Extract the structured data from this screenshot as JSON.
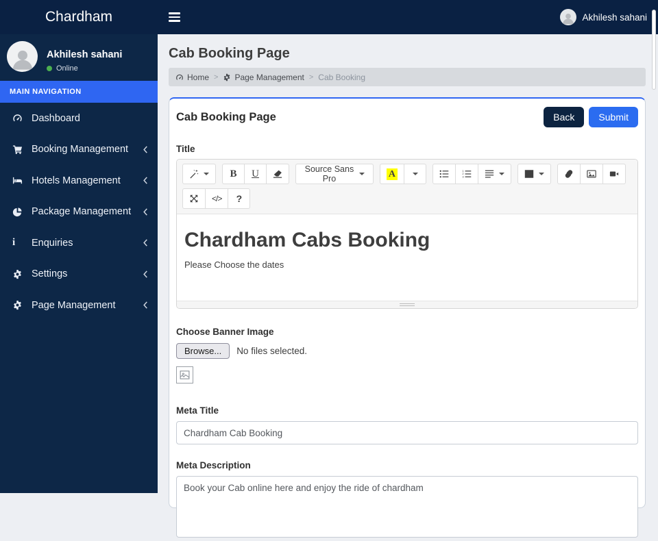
{
  "header": {
    "brand": "Chardham",
    "user_name": "Akhilesh sahani"
  },
  "sidebar": {
    "user": {
      "name": "Akhilesh sahani",
      "status": "Online"
    },
    "section_label": "MAIN NAVIGATION",
    "info_icon_letter": "i",
    "items": [
      {
        "label": "Dashboard",
        "icon": "tachometer",
        "has_children": false
      },
      {
        "label": "Booking Management",
        "icon": "cart",
        "has_children": true
      },
      {
        "label": "Hotels Management",
        "icon": "bed",
        "has_children": true
      },
      {
        "label": "Package Management",
        "icon": "pie-chart",
        "has_children": true
      },
      {
        "label": "Enquiries",
        "icon": "info",
        "has_children": true
      },
      {
        "label": "Settings",
        "icon": "gear",
        "has_children": true
      },
      {
        "label": "Page Management",
        "icon": "gear",
        "has_children": true
      }
    ]
  },
  "content": {
    "page_title": "Cab Booking Page",
    "breadcrumb": {
      "separator": ">",
      "items": [
        {
          "label": "Home",
          "icon": "tachometer"
        },
        {
          "label": "Page Management",
          "icon": "gear"
        },
        {
          "label": "Cab Booking"
        }
      ]
    },
    "card": {
      "title": "Cab Booking Page",
      "back_label": "Back",
      "submit_label": "Submit",
      "title_label": "Title",
      "editor": {
        "toolbar": {
          "bold": "B",
          "underline": "U",
          "font_name": "Source Sans Pro",
          "color_letter": "A",
          "codeview": "</>",
          "help": "?"
        },
        "heading": "Chardham Cabs Booking",
        "paragraph": "Please Choose the dates"
      },
      "banner": {
        "label": "Choose Banner Image",
        "browse_label": "Browse...",
        "no_file_text": "No files selected."
      },
      "meta_title": {
        "label": "Meta Title",
        "value": "Chardham Cab Booking"
      },
      "meta_description": {
        "label": "Meta Description",
        "value": "Book your Cab online here and enjoy the ride of chardham"
      }
    }
  },
  "colors": {
    "header_navy": "#0a2143",
    "sidebar_navy": "#0d2747",
    "nav_header_blue": "#2f66f2",
    "submit_blue": "#2b6cf0",
    "back_navy": "#0c2340",
    "online_green": "#4caf50",
    "highlight_yellow": "#ffff00",
    "content_bg": "#edeff3",
    "breadcrumb_bg": "#d7dade"
  }
}
